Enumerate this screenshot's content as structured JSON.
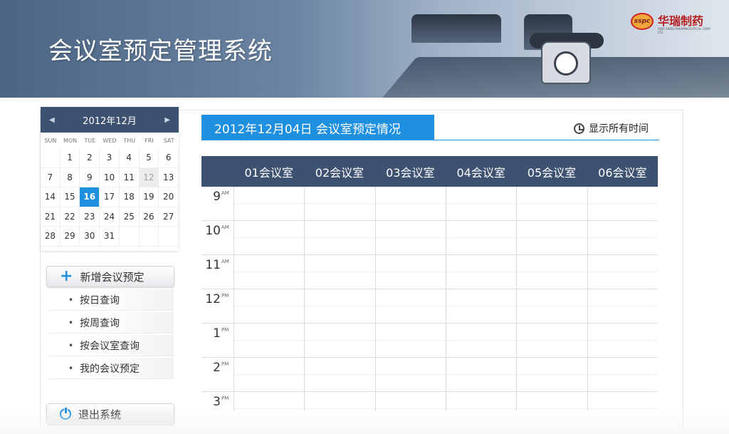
{
  "header": {
    "title": "会议室预定管理系统",
    "logo": {
      "mark": "sspc",
      "name": "华瑞制药",
      "sub": "SINO SWED PHARMACEUTICAL CORP. LTD."
    }
  },
  "calendar": {
    "month_label": "2012年12月",
    "dow": [
      "SUN",
      "MON",
      "TUE",
      "WED",
      "THU",
      "FRI",
      "SAT"
    ],
    "weeks": [
      [
        "",
        "1",
        "2",
        "3",
        "4",
        "5",
        "6"
      ],
      [
        "7",
        "8",
        "9",
        "10",
        "11",
        "12",
        "13"
      ],
      [
        "14",
        "15",
        "16",
        "17",
        "18",
        "19",
        "20"
      ],
      [
        "21",
        "22",
        "23",
        "24",
        "25",
        "26",
        "27"
      ],
      [
        "28",
        "29",
        "30",
        "31",
        "",
        "",
        ""
      ]
    ],
    "selected": "16",
    "muted": "12"
  },
  "sidebar": {
    "new_booking": "新增会议预定",
    "items": [
      "按日查询",
      "按周查询",
      "按会议室查询",
      "我的会议预定"
    ],
    "logout": "退出系统"
  },
  "schedule": {
    "date_title": "2012年12月04日 会议室预定情况",
    "show_all": "显示所有时间",
    "rooms": [
      "01会议室",
      "02会议室",
      "03会议室",
      "04会议室",
      "05会议室",
      "06会议室"
    ],
    "times": [
      {
        "h": "9",
        "ap": "AM"
      },
      {
        "h": "10",
        "ap": "AM"
      },
      {
        "h": "11",
        "ap": "AM"
      },
      {
        "h": "12",
        "ap": "PM"
      },
      {
        "h": "1",
        "ap": "PM"
      },
      {
        "h": "2",
        "ap": "PM"
      },
      {
        "h": "3",
        "ap": "PM"
      }
    ]
  }
}
